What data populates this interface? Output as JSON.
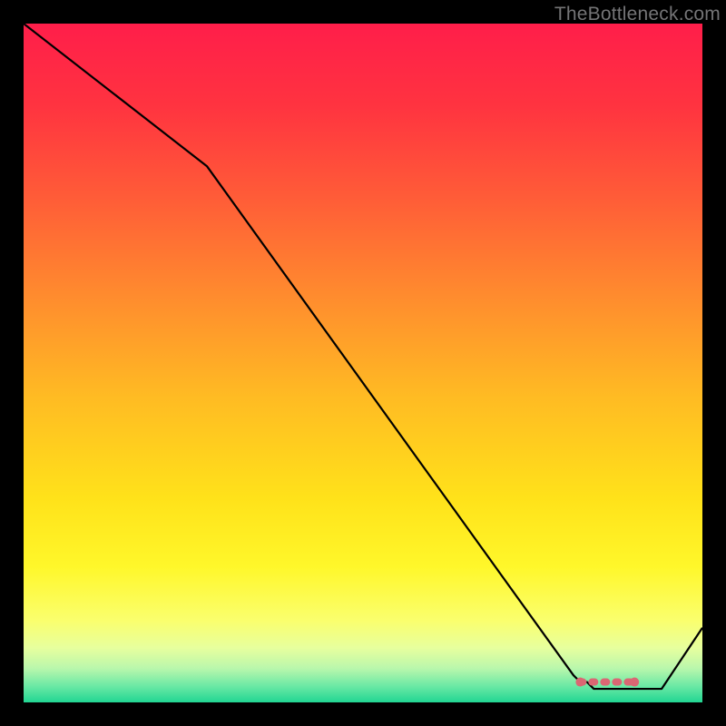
{
  "attribution": "TheBottleneck.com",
  "chart_data": {
    "type": "line",
    "title": "",
    "xlabel": "",
    "ylabel": "",
    "xlim": [
      0,
      100
    ],
    "ylim": [
      0,
      100
    ],
    "grid": false,
    "series": [
      {
        "name": "curve",
        "x": [
          0,
          27,
          81,
          82,
          83,
          84,
          85,
          86,
          87,
          88,
          94,
          100
        ],
        "values": [
          100,
          79,
          4,
          3,
          3,
          2,
          2,
          2,
          2,
          2,
          2,
          11
        ]
      }
    ],
    "markers": {
      "x": [
        82,
        83,
        84,
        85,
        86,
        87,
        88,
        89,
        90
      ],
      "values": [
        3,
        3,
        3,
        3,
        3,
        3,
        3,
        3,
        3
      ],
      "color": "#da6773"
    },
    "background_gradient_stops": [
      {
        "offset": 0.0,
        "color": "#ff1e4a"
      },
      {
        "offset": 0.12,
        "color": "#ff3340"
      },
      {
        "offset": 0.25,
        "color": "#ff5a38"
      },
      {
        "offset": 0.4,
        "color": "#ff8b2e"
      },
      {
        "offset": 0.55,
        "color": "#ffbb23"
      },
      {
        "offset": 0.7,
        "color": "#ffe21a"
      },
      {
        "offset": 0.8,
        "color": "#fff72a"
      },
      {
        "offset": 0.88,
        "color": "#faff6e"
      },
      {
        "offset": 0.92,
        "color": "#e7ff9e"
      },
      {
        "offset": 0.95,
        "color": "#b9f7ac"
      },
      {
        "offset": 0.975,
        "color": "#6ee9a5"
      },
      {
        "offset": 1.0,
        "color": "#22d693"
      }
    ]
  }
}
